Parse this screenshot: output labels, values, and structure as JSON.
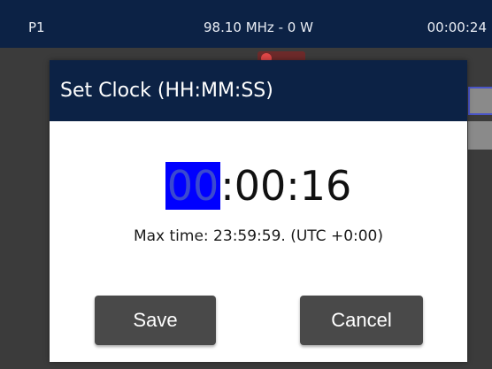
{
  "status_bar": {
    "preset": "P1",
    "frequency_power": "98.10 MHz - 0 W",
    "clock": "00:00:24"
  },
  "dialog": {
    "title": "Set Clock (HH:MM:SS)",
    "time": {
      "hours": "00",
      "rest": ":00:16"
    },
    "max_time": "Max time: 23:59:59. (UTC +0:00)",
    "save_label": "Save",
    "cancel_label": "Cancel"
  },
  "colors": {
    "header": "#0c2245",
    "selection": "#0000ff",
    "button": "#494949"
  }
}
